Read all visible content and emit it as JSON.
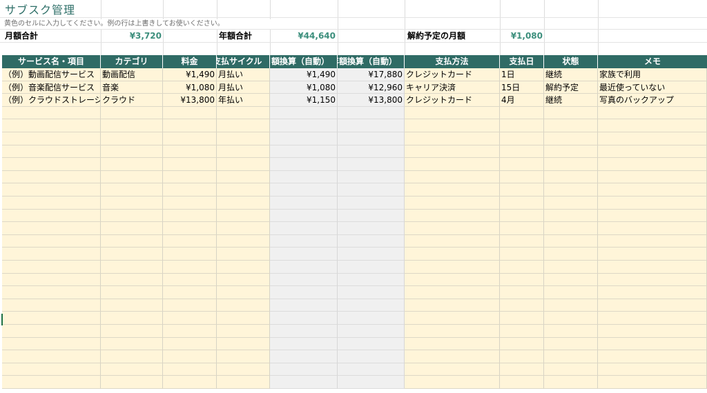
{
  "title": "サブスク管理",
  "note": "黄色のセルに入力してください。例の行は上書きしてお使いください。",
  "summary": {
    "monthly_label": "月額合計",
    "monthly_value": "¥3,720",
    "yearly_label": "年額合計",
    "yearly_value": "¥44,640",
    "cancel_label": "解約予定の月額",
    "cancel_value": "¥1,080"
  },
  "headers": [
    "サービス名・項目",
    "カテゴリ",
    "料金",
    "支払サイクル",
    "月額換算（自動）",
    "年額換算（自動）",
    "支払方法",
    "支払日",
    "状態",
    "メモ"
  ],
  "rows": [
    [
      "（例）動画配信サービス",
      "動画配信",
      "¥1,490",
      "月払い",
      "¥1,490",
      "¥17,880",
      "クレジットカード",
      "1日",
      "継続",
      "家族で利用"
    ],
    [
      "（例）音楽配信サービス",
      "音楽",
      "¥1,080",
      "月払い",
      "¥1,080",
      "¥12,960",
      "キャリア決済",
      "15日",
      "解約予定",
      "最近使っていない"
    ],
    [
      "（例）クラウドストレージ",
      "クラウド",
      "¥13,800",
      "年払い",
      "¥1,150",
      "¥13,800",
      "クレジットカード",
      "4月",
      "継続",
      "写真のバックアップ"
    ]
  ],
  "colors": {
    "header_bg": "#2f6b65",
    "input_cell": "#fff5d9",
    "auto_cell": "#f0f0f0",
    "accent_value": "#3d8f7d",
    "title_text": "#2e6f68"
  }
}
